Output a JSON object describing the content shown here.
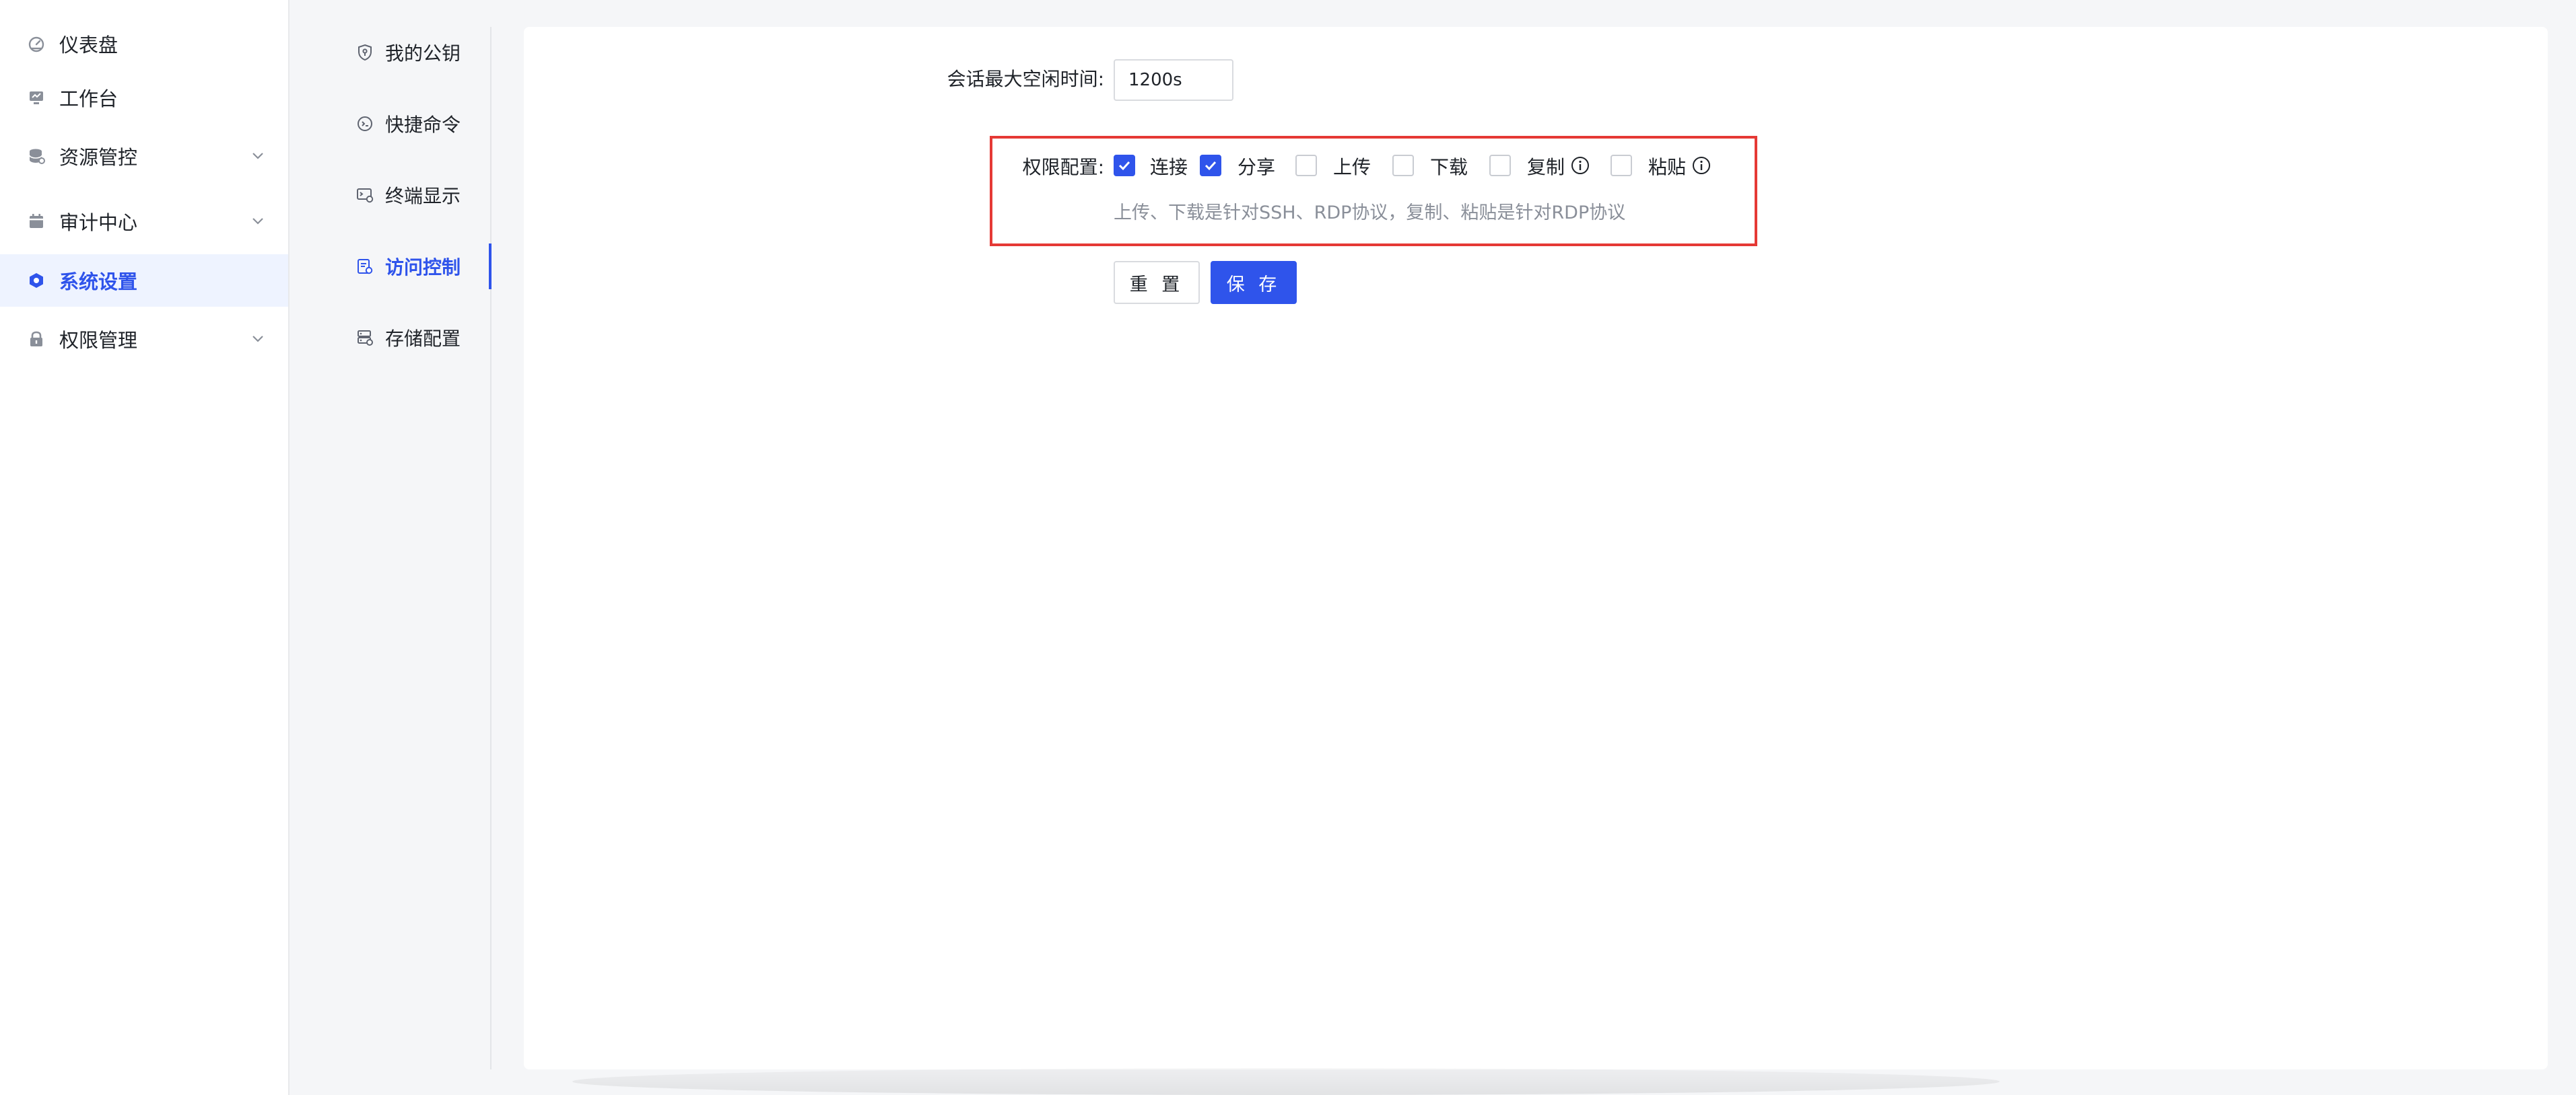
{
  "sidebar": {
    "items": [
      {
        "label": "仪表盘",
        "icon": "dashboard-icon"
      },
      {
        "label": "工作台",
        "icon": "workbench-icon"
      },
      {
        "label": "资源管控",
        "icon": "database-icon"
      },
      {
        "label": "审计中心",
        "icon": "calendar-icon"
      },
      {
        "label": "系统设置",
        "icon": "settings-hexagon-icon"
      },
      {
        "label": "权限管理",
        "icon": "lock-icon"
      }
    ]
  },
  "submenu": {
    "items": [
      {
        "label": "我的公钥",
        "icon": "shield-key-icon"
      },
      {
        "label": "快捷命令",
        "icon": "command-icon"
      },
      {
        "label": "终端显示",
        "icon": "terminal-display-icon"
      },
      {
        "label": "访问控制",
        "icon": "access-control-icon"
      },
      {
        "label": "存储配置",
        "icon": "storage-icon"
      }
    ]
  },
  "form": {
    "idle_label": "会话最大空闲时间:",
    "idle_value": "1200s",
    "perm_label": "权限配置:",
    "permissions": [
      {
        "label": "连接",
        "checked": true
      },
      {
        "label": "分享",
        "checked": true
      },
      {
        "label": "上传",
        "checked": false
      },
      {
        "label": "下载",
        "checked": false
      },
      {
        "label": "复制",
        "checked": false
      },
      {
        "label": "粘贴",
        "checked": false
      }
    ],
    "hint": "上传、下载是针对SSH、RDP协议，复制、粘贴是针对RDP协议",
    "reset_label": "重 置",
    "save_label": "保 存"
  },
  "colors": {
    "accent": "#2f54eb",
    "highlight": "#e53935"
  }
}
